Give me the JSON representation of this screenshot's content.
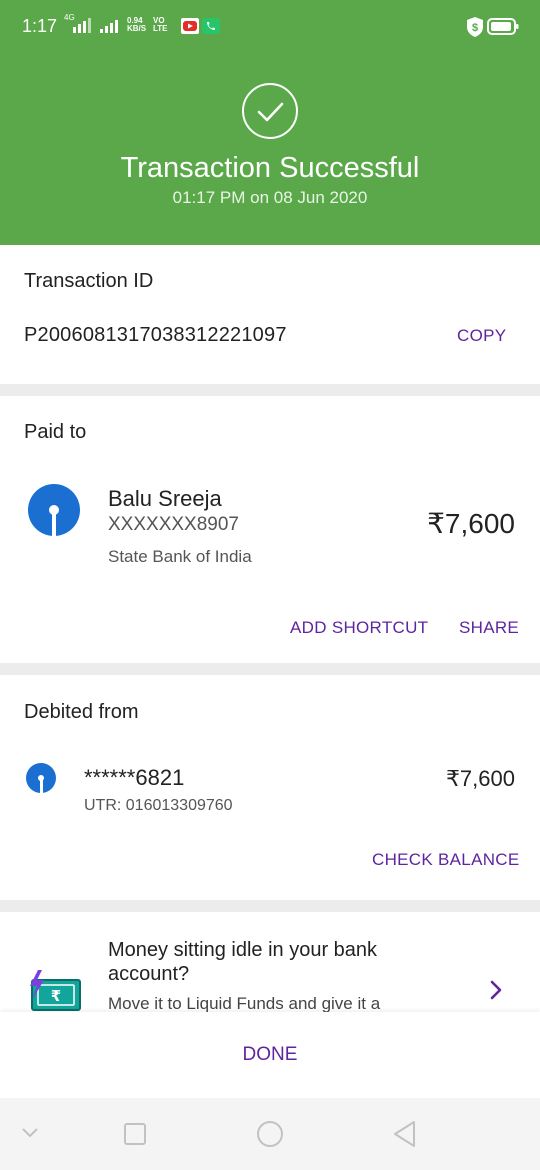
{
  "status_bar": {
    "time": "1:17",
    "network_label": "4G",
    "speed_value": "0.94",
    "speed_unit": "KB/S",
    "volte_top": "VO",
    "volte_bottom": "LTE",
    "icons": [
      "signal-icon",
      "youtube-icon",
      "phone-icon",
      "shield-dollar-icon",
      "battery-icon"
    ]
  },
  "header": {
    "title": "Transaction Successful",
    "subtitle": "01:17 PM on 08 Jun 2020",
    "accent_color": "#5aa84a"
  },
  "transaction": {
    "label": "Transaction ID",
    "id": "P2006081317038312221097",
    "copy_label": "COPY"
  },
  "paid_to": {
    "label": "Paid to",
    "name": "Balu Sreeja",
    "account": "XXXXXXX8907",
    "bank": "State Bank of India",
    "amount": "₹7,600",
    "add_shortcut_label": "ADD SHORTCUT",
    "share_label": "SHARE"
  },
  "debited_from": {
    "label": "Debited from",
    "account": "******6821",
    "utr": "UTR: 016013309760",
    "amount": "₹7,600",
    "check_balance_label": "CHECK BALANCE"
  },
  "promo": {
    "title": "Money sitting idle in your bank account?",
    "body": "Move it to Liquid Funds and give it a"
  },
  "footer": {
    "done_label": "DONE"
  },
  "colors": {
    "link": "#5f259f",
    "sbi_blue": "#1a6fd1"
  }
}
